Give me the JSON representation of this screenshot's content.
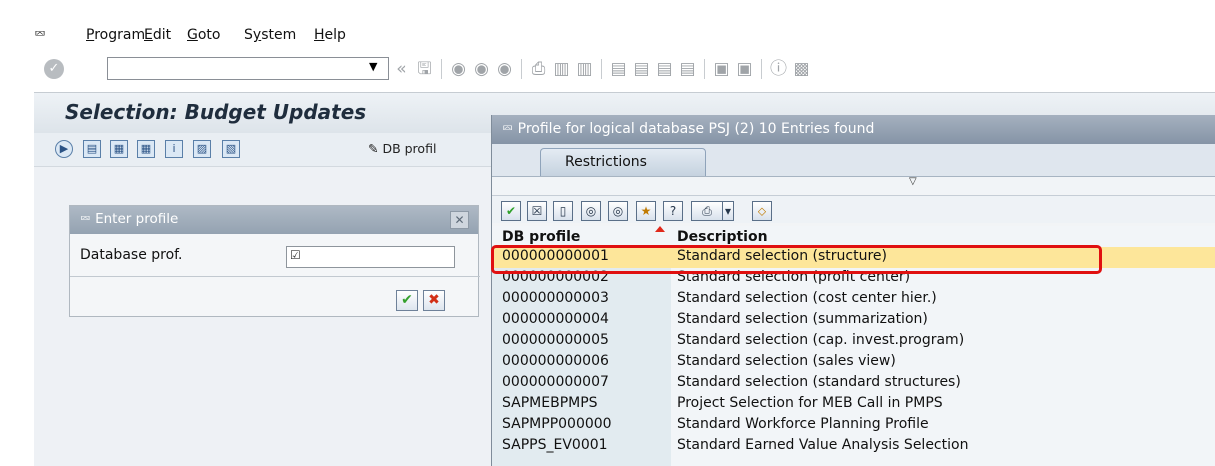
{
  "menu": {
    "items": [
      {
        "label": "Program",
        "underline": "P"
      },
      {
        "label": "Edit",
        "underline": "E"
      },
      {
        "label": "Goto",
        "underline": "G"
      },
      {
        "label": "System",
        "underline": "y"
      },
      {
        "label": "Help",
        "underline": "H"
      }
    ]
  },
  "toolbar": {
    "command_field_value": "",
    "icons": [
      "back-icon",
      "save-icon",
      "back-nav-icon",
      "exit-icon",
      "cancel-icon",
      "print-icon",
      "find-icon",
      "find-next-icon",
      "first-page-icon",
      "previous-page-icon",
      "next-page-icon",
      "last-page-icon",
      "new-session-icon",
      "shortcut-icon",
      "help-icon",
      "layout-icon"
    ]
  },
  "main": {
    "title": "Selection: Budget Updates",
    "db_profile_button": "DB profil"
  },
  "dialog": {
    "title": "Enter profile",
    "field_label": "Database prof.",
    "field_value": ""
  },
  "popup": {
    "title": "Profile for logical database PSJ (2)   10 Entries found",
    "tab": "Restrictions",
    "columns": [
      "DB profile",
      "Description"
    ],
    "rows": [
      {
        "profile": "000000000001",
        "description": "Standard selection (structure)",
        "selected": true
      },
      {
        "profile": "000000000002",
        "description": "Standard selection (profit center)"
      },
      {
        "profile": "000000000003",
        "description": "Standard selection (cost center hier.)"
      },
      {
        "profile": "000000000004",
        "description": "Standard selection (summarization)"
      },
      {
        "profile": "000000000005",
        "description": "Standard selection (cap. invest.program)"
      },
      {
        "profile": "000000000006",
        "description": "Standard selection (sales view)"
      },
      {
        "profile": "000000000007",
        "description": "Standard selection (standard structures)"
      },
      {
        "profile": "SAPMEBPMPS",
        "description": "Project Selection for MEB Call in PMPS"
      },
      {
        "profile": "SAPMPP000000",
        "description": "Standard Workforce Planning Profile"
      },
      {
        "profile": "SAPPS_EV0001",
        "description": "Standard Earned Value Analysis Selection"
      }
    ]
  },
  "colors": {
    "selection_highlight": "#fde69a",
    "annotation_box": "#e01010",
    "popup_title_bar": "#8594a6"
  }
}
